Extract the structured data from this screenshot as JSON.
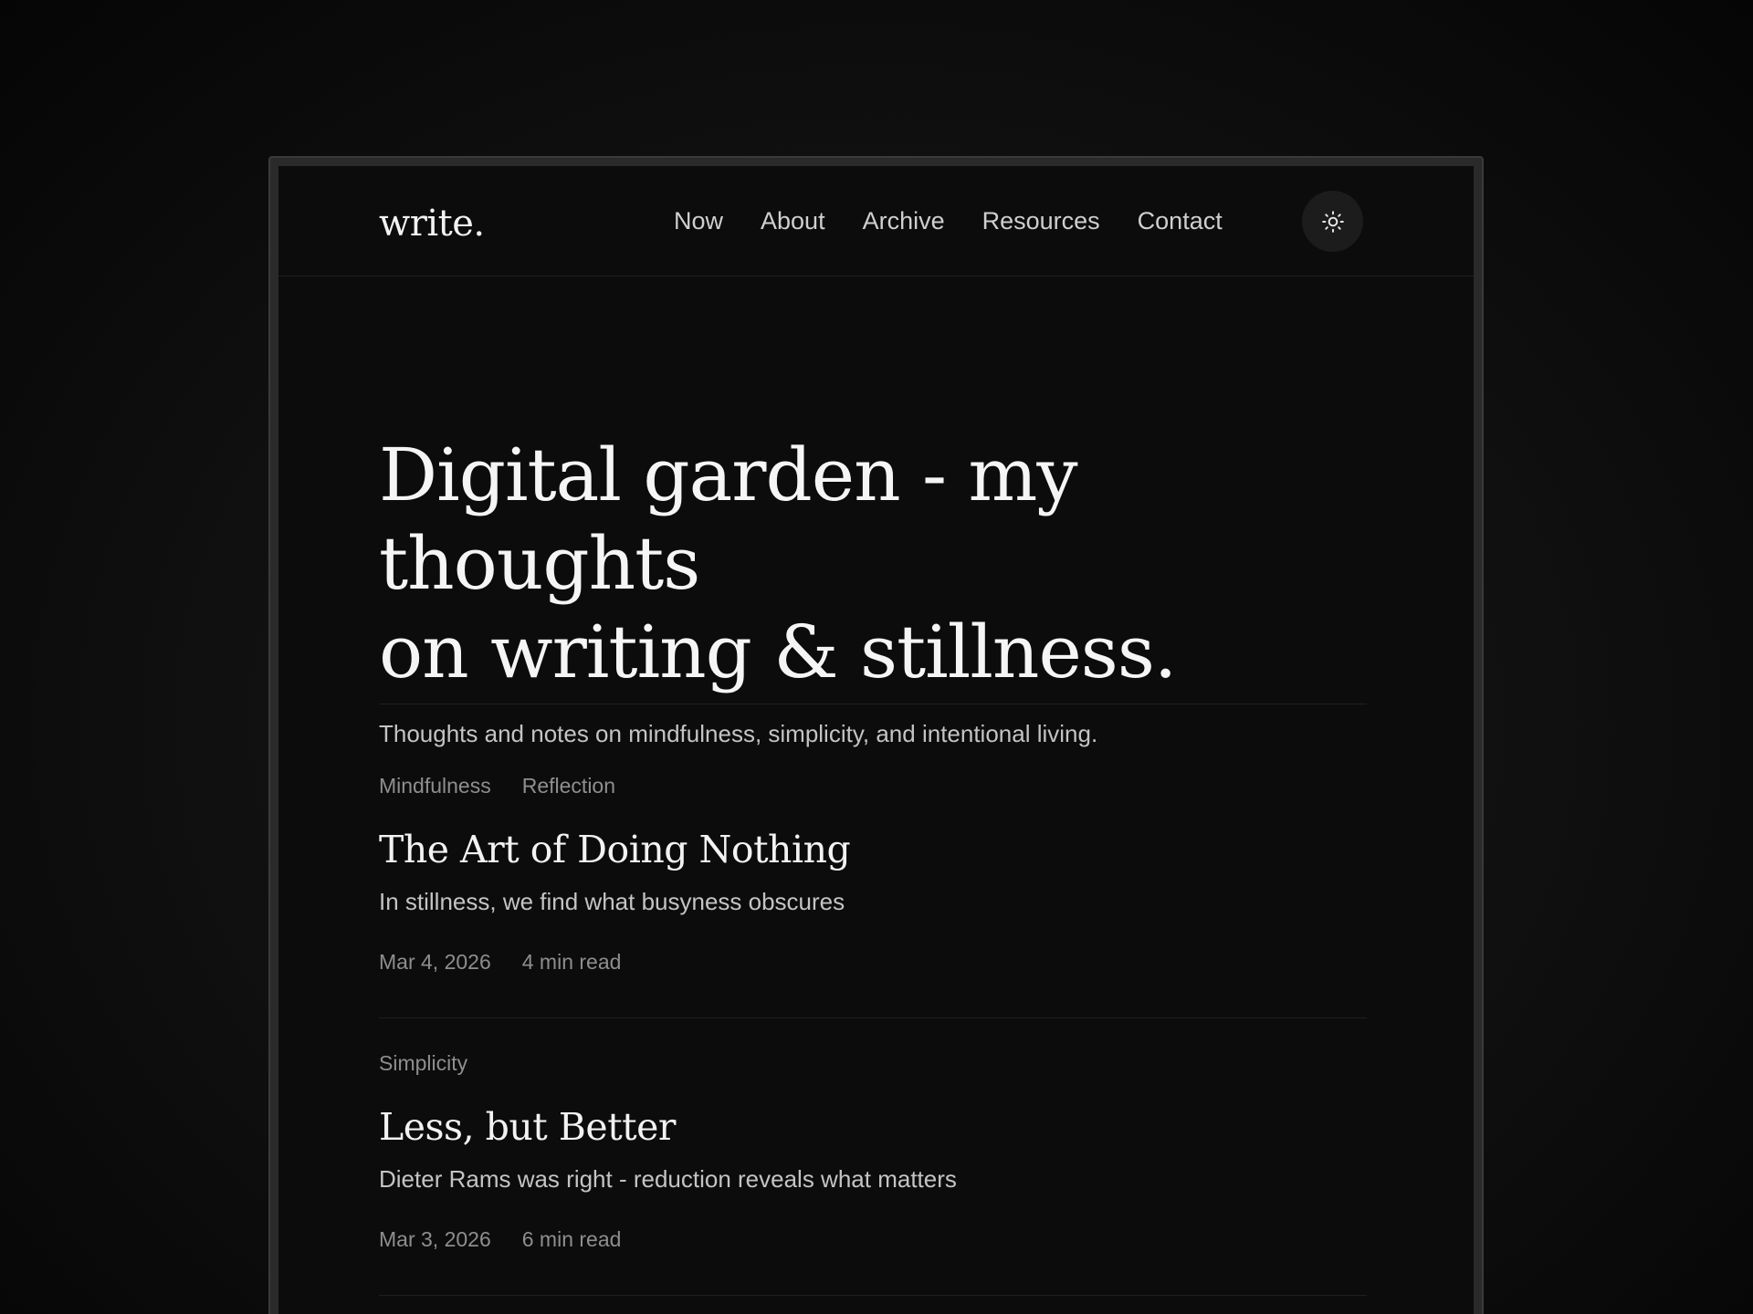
{
  "site": {
    "logo": "write."
  },
  "nav": {
    "items": [
      {
        "label": "Now"
      },
      {
        "label": "About"
      },
      {
        "label": "Archive"
      },
      {
        "label": "Resources"
      },
      {
        "label": "Contact"
      }
    ],
    "theme_toggle_icon": "sun-icon"
  },
  "hero": {
    "title_line1": "Digital garden - my thoughts",
    "title_line2": "on writing & stillness.",
    "subtitle": "Thoughts and notes on mindfulness, simplicity, and intentional living."
  },
  "posts": [
    {
      "tags": [
        "Mindfulness",
        "Reflection"
      ],
      "title": "The Art of Doing Nothing",
      "excerpt": "In stillness, we find what busyness obscures",
      "date": "Mar 4, 2026",
      "read_time": "4 min read"
    },
    {
      "tags": [
        "Simplicity"
      ],
      "title": "Less, but Better",
      "excerpt": "Dieter Rams was right - reduction reveals what matters",
      "date": "Mar 3, 2026",
      "read_time": "6 min read"
    }
  ],
  "colors": {
    "background": "#0c0c0c",
    "text_primary": "#f2f2f2",
    "text_secondary": "#c4c4c4",
    "text_muted": "#8e8e8e"
  }
}
